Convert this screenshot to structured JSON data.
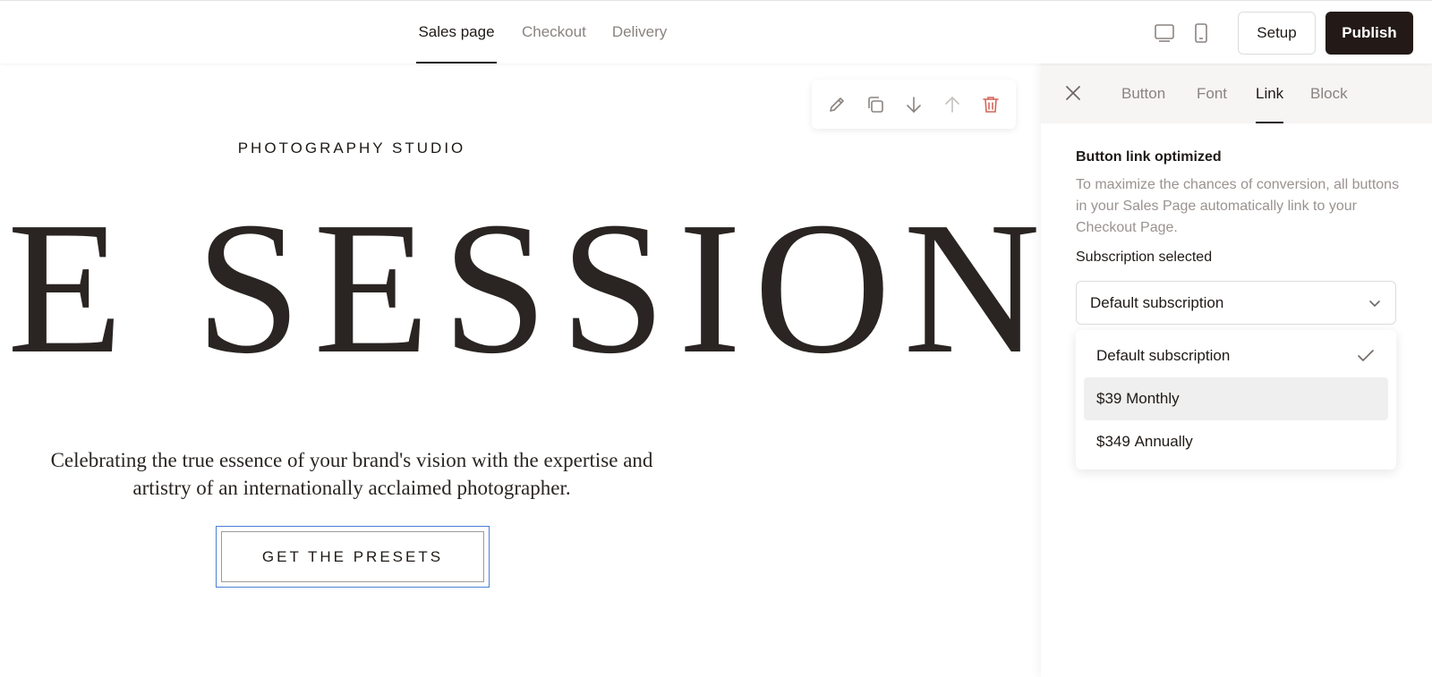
{
  "header": {
    "tabs": [
      "Sales page",
      "Checkout",
      "Delivery"
    ],
    "active_tab": "Sales page",
    "setup_label": "Setup",
    "publish_label": "Publish"
  },
  "canvas": {
    "eyebrow": "PHOTOGRAPHY STUDIO",
    "hero_title": "E SESSION",
    "subtitle_line1": "Celebrating the true essence of your brand's vision with the expertise and",
    "subtitle_line2": "artistry of an internationally acclaimed photographer.",
    "cta_label": "GET THE PRESETS",
    "delete_color": "#d4675a"
  },
  "panel": {
    "tabs": [
      "Button",
      "Font",
      "Link",
      "Block"
    ],
    "active_tab": "Link",
    "heading": "Button link optimized",
    "description": "To maximize the chances of conversion, all buttons in your Sales Page automatically link to your Checkout Page.",
    "subscription_label": "Subscription selected",
    "select_value": "Default subscription",
    "options": [
      {
        "price": "",
        "label": "Default subscription",
        "selected": true
      },
      {
        "price": "$39",
        "label": "Monthly",
        "selected": false
      },
      {
        "price": "$349",
        "label": "Annually",
        "selected": false
      }
    ]
  },
  "colors": {
    "accent": "#231a17",
    "selection_outline": "#4a7fd4"
  }
}
